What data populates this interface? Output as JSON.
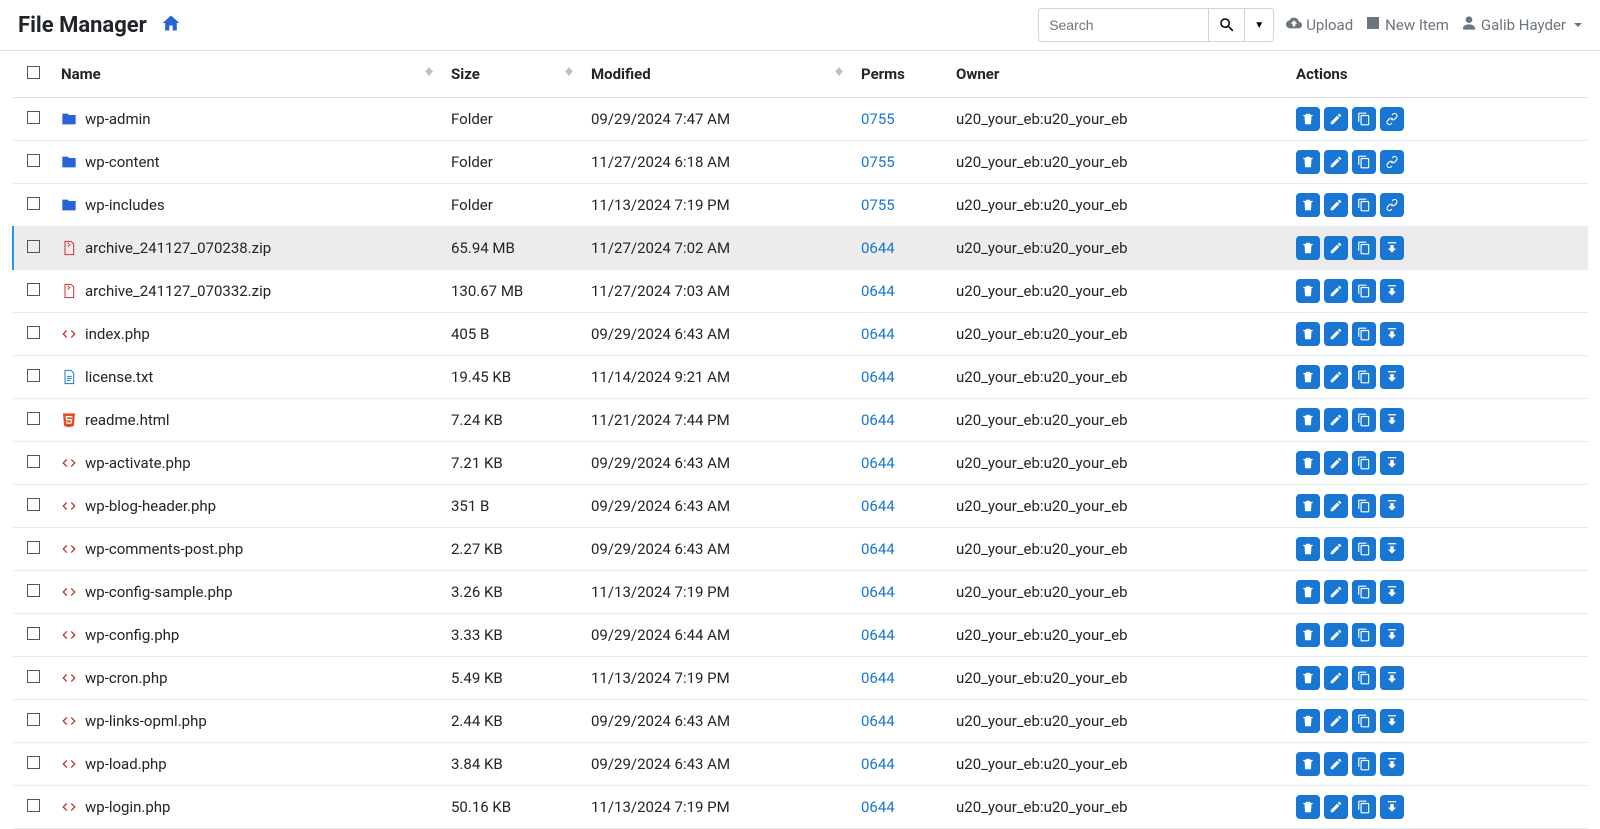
{
  "header": {
    "title": "File Manager",
    "search_placeholder": "Search",
    "upload": "Upload",
    "new_item": "New Item",
    "user": "Galib Hayder"
  },
  "columns": {
    "name": "Name",
    "size": "Size",
    "modified": "Modified",
    "perms": "Perms",
    "owner": "Owner",
    "actions": "Actions"
  },
  "rows": [
    {
      "type": "folder",
      "name": "wp-admin",
      "size": "Folder",
      "modified": "09/29/2024 7:47 AM",
      "perms": "0755",
      "owner": "u20_your_eb:u20_your_eb",
      "actions": [
        "delete",
        "edit",
        "copy",
        "link"
      ]
    },
    {
      "type": "folder",
      "name": "wp-content",
      "size": "Folder",
      "modified": "11/27/2024 6:18 AM",
      "perms": "0755",
      "owner": "u20_your_eb:u20_your_eb",
      "actions": [
        "delete",
        "edit",
        "copy",
        "link"
      ]
    },
    {
      "type": "folder",
      "name": "wp-includes",
      "size": "Folder",
      "modified": "11/13/2024 7:19 PM",
      "perms": "0755",
      "owner": "u20_your_eb:u20_your_eb",
      "actions": [
        "delete",
        "edit",
        "copy",
        "link"
      ]
    },
    {
      "type": "zip",
      "name": "archive_241127_070238.zip",
      "size": "65.94 MB",
      "modified": "11/27/2024 7:02 AM",
      "perms": "0644",
      "owner": "u20_your_eb:u20_your_eb",
      "actions": [
        "delete",
        "edit",
        "copy",
        "download"
      ],
      "hovered": true
    },
    {
      "type": "zip",
      "name": "archive_241127_070332.zip",
      "size": "130.67 MB",
      "modified": "11/27/2024 7:03 AM",
      "perms": "0644",
      "owner": "u20_your_eb:u20_your_eb",
      "actions": [
        "delete",
        "edit",
        "copy",
        "download"
      ]
    },
    {
      "type": "php",
      "name": "index.php",
      "size": "405 B",
      "modified": "09/29/2024 6:43 AM",
      "perms": "0644",
      "owner": "u20_your_eb:u20_your_eb",
      "actions": [
        "delete",
        "edit",
        "copy",
        "download"
      ]
    },
    {
      "type": "txt",
      "name": "license.txt",
      "size": "19.45 KB",
      "modified": "11/14/2024 9:21 AM",
      "perms": "0644",
      "owner": "u20_your_eb:u20_your_eb",
      "actions": [
        "delete",
        "edit",
        "copy",
        "download"
      ]
    },
    {
      "type": "html",
      "name": "readme.html",
      "size": "7.24 KB",
      "modified": "11/21/2024 7:44 PM",
      "perms": "0644",
      "owner": "u20_your_eb:u20_your_eb",
      "actions": [
        "delete",
        "edit",
        "copy",
        "download"
      ]
    },
    {
      "type": "php",
      "name": "wp-activate.php",
      "size": "7.21 KB",
      "modified": "09/29/2024 6:43 AM",
      "perms": "0644",
      "owner": "u20_your_eb:u20_your_eb",
      "actions": [
        "delete",
        "edit",
        "copy",
        "download"
      ]
    },
    {
      "type": "php",
      "name": "wp-blog-header.php",
      "size": "351 B",
      "modified": "09/29/2024 6:43 AM",
      "perms": "0644",
      "owner": "u20_your_eb:u20_your_eb",
      "actions": [
        "delete",
        "edit",
        "copy",
        "download"
      ]
    },
    {
      "type": "php",
      "name": "wp-comments-post.php",
      "size": "2.27 KB",
      "modified": "09/29/2024 6:43 AM",
      "perms": "0644",
      "owner": "u20_your_eb:u20_your_eb",
      "actions": [
        "delete",
        "edit",
        "copy",
        "download"
      ]
    },
    {
      "type": "php",
      "name": "wp-config-sample.php",
      "size": "3.26 KB",
      "modified": "11/13/2024 7:19 PM",
      "perms": "0644",
      "owner": "u20_your_eb:u20_your_eb",
      "actions": [
        "delete",
        "edit",
        "copy",
        "download"
      ]
    },
    {
      "type": "php",
      "name": "wp-config.php",
      "size": "3.33 KB",
      "modified": "09/29/2024 6:44 AM",
      "perms": "0644",
      "owner": "u20_your_eb:u20_your_eb",
      "actions": [
        "delete",
        "edit",
        "copy",
        "download"
      ]
    },
    {
      "type": "php",
      "name": "wp-cron.php",
      "size": "5.49 KB",
      "modified": "11/13/2024 7:19 PM",
      "perms": "0644",
      "owner": "u20_your_eb:u20_your_eb",
      "actions": [
        "delete",
        "edit",
        "copy",
        "download"
      ]
    },
    {
      "type": "php",
      "name": "wp-links-opml.php",
      "size": "2.44 KB",
      "modified": "09/29/2024 6:43 AM",
      "perms": "0644",
      "owner": "u20_your_eb:u20_your_eb",
      "actions": [
        "delete",
        "edit",
        "copy",
        "download"
      ]
    },
    {
      "type": "php",
      "name": "wp-load.php",
      "size": "3.84 KB",
      "modified": "09/29/2024 6:43 AM",
      "perms": "0644",
      "owner": "u20_your_eb:u20_your_eb",
      "actions": [
        "delete",
        "edit",
        "copy",
        "download"
      ]
    },
    {
      "type": "php",
      "name": "wp-login.php",
      "size": "50.16 KB",
      "modified": "11/13/2024 7:19 PM",
      "perms": "0644",
      "owner": "u20_your_eb:u20_your_eb",
      "actions": [
        "delete",
        "edit",
        "copy",
        "download"
      ]
    }
  ]
}
